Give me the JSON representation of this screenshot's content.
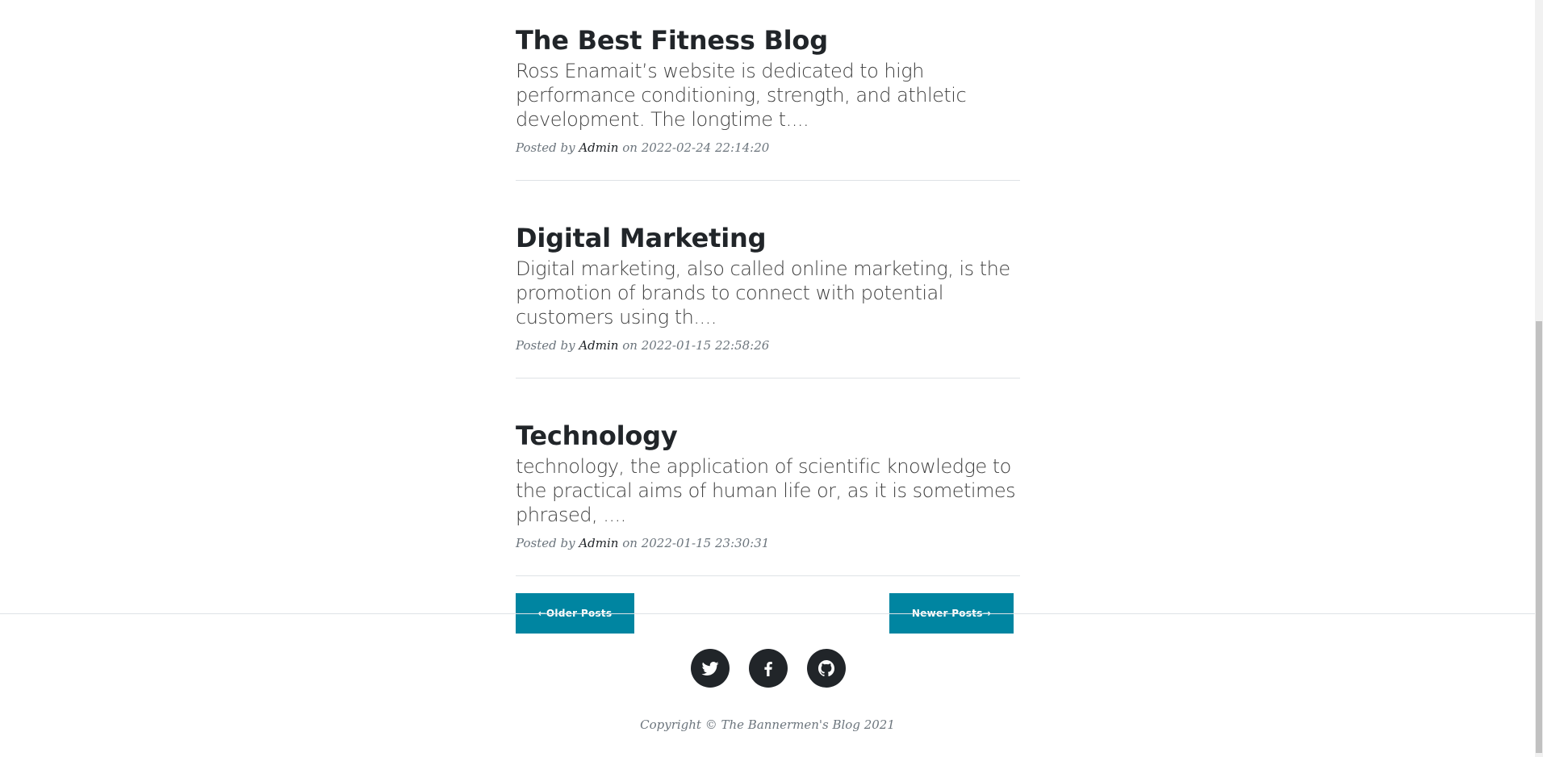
{
  "posts": [
    {
      "title": "The Best Fitness Blog",
      "excerpt": "Ross Enamait’s website is dedicated to high performance conditioning, strength, and athletic development. The longtime t....",
      "meta_prefix": "Posted by ",
      "author": "Admin",
      "meta_on": " on ",
      "date": "2022-02-24 22:14:20"
    },
    {
      "title": "Digital Marketing",
      "excerpt": "Digital marketing, also called online marketing, is the promotion of brands to connect with potential customers using th....",
      "meta_prefix": "Posted by ",
      "author": "Admin",
      "meta_on": " on ",
      "date": "2022-01-15 22:58:26"
    },
    {
      "title": "Technology",
      "excerpt": "technology, the application of scientific knowledge to the practical aims of human life or, as it is sometimes phrased, ....",
      "meta_prefix": "Posted by ",
      "author": "Admin",
      "meta_on": " on ",
      "date": "2022-01-15 23:30:31"
    }
  ],
  "pager": {
    "older_label": "←Older Posts",
    "newer_label": "Newer Posts→"
  },
  "footer": {
    "social": [
      {
        "icon": "twitter-icon"
      },
      {
        "icon": "facebook-icon"
      },
      {
        "icon": "github-icon"
      }
    ],
    "copyright": "Copyright © The Bannermen's Blog 2021"
  },
  "colors": {
    "button": "#0085a1",
    "social_circle": "#212529",
    "meta_text": "#6c757d",
    "rule": "#dee2e6"
  }
}
